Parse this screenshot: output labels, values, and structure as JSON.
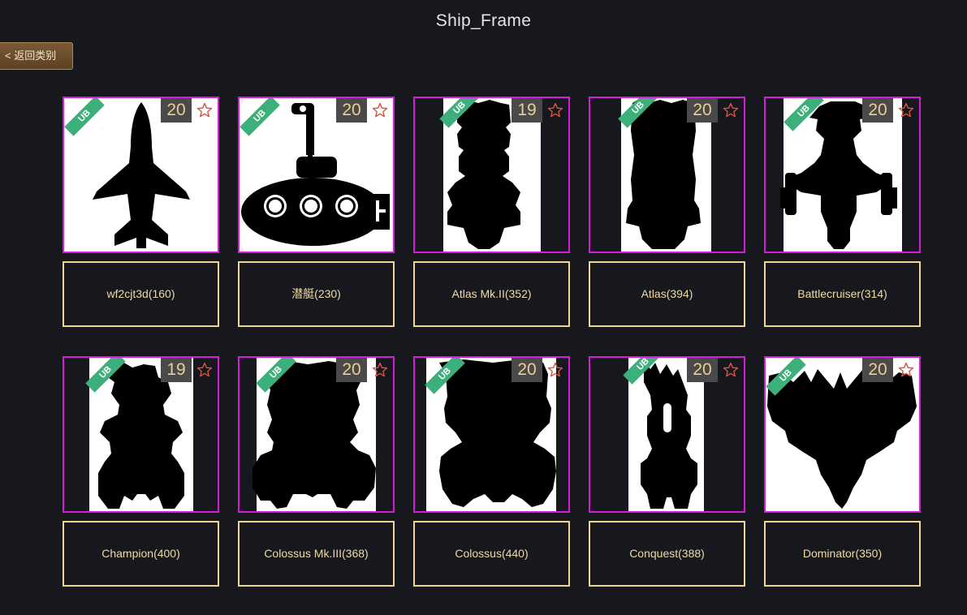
{
  "title": "Ship_Frame",
  "back_label": "< 返回类别",
  "badge_text": "UB",
  "items": [
    {
      "name": "wf2cjt3d(160)",
      "count": "20",
      "shape": "jet"
    },
    {
      "name": "潜艇(230)",
      "count": "20",
      "shape": "sub"
    },
    {
      "name": "Atlas Mk.II(352)",
      "count": "19",
      "shape": "atlas2"
    },
    {
      "name": "Atlas(394)",
      "count": "20",
      "shape": "atlas"
    },
    {
      "name": "Battlecruiser(314)",
      "count": "20",
      "shape": "battlecruiser"
    },
    {
      "name": "Champion(400)",
      "count": "19",
      "shape": "champion"
    },
    {
      "name": "Colossus Mk.III(368)",
      "count": "20",
      "shape": "colossus3"
    },
    {
      "name": "Colossus(440)",
      "count": "20",
      "shape": "colossus"
    },
    {
      "name": "Conquest(388)",
      "count": "20",
      "shape": "conquest"
    },
    {
      "name": "Dominator(350)",
      "count": "20",
      "shape": "dominator"
    }
  ],
  "colors": {
    "background": "#16181d",
    "thumb_border": "#dd18dd",
    "label_border": "#f0d490",
    "label_text": "#efd9a6",
    "count_text": "#e8cf94",
    "badge": "#3bb07a",
    "star": "#d9533f"
  },
  "icons": {
    "favorite": "star-outline-icon",
    "badge": "ub-ribbon-icon"
  }
}
